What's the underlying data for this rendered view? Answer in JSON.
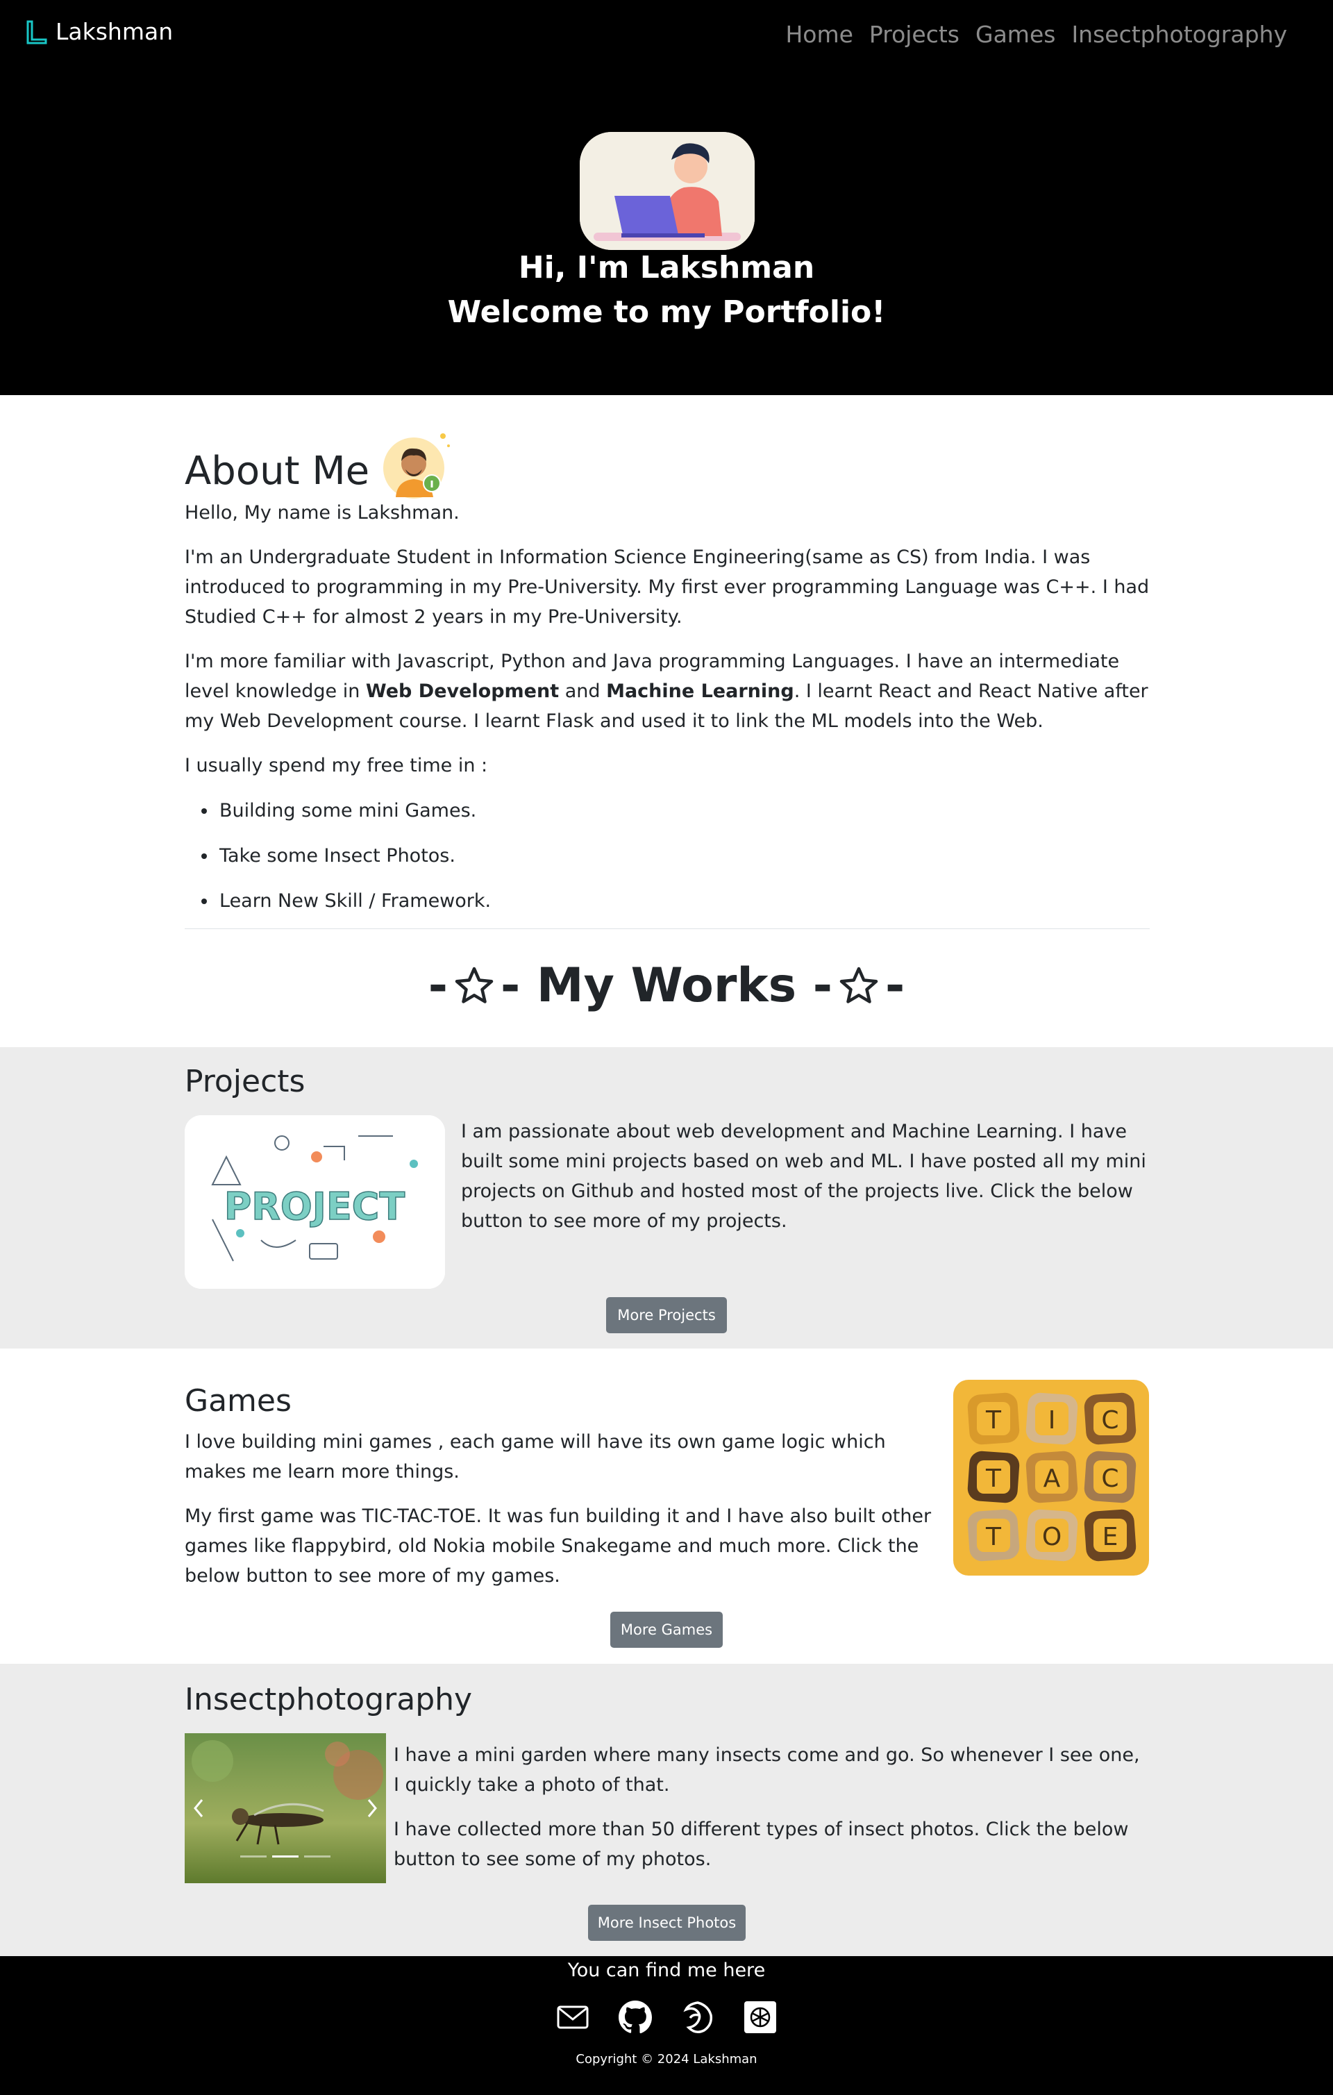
{
  "navbar": {
    "brand": "Lakshman",
    "links": [
      "Home",
      "Projects",
      "Games",
      "Insectphotography"
    ]
  },
  "hero": {
    "line1": "Hi, I'm Lakshman",
    "line2": "Welcome to my Portfolio!"
  },
  "about": {
    "title": "About Me",
    "p1": "Hello, My name is Lakshman.",
    "p2": "I'm an Undergraduate Student in Information Science Engineering(same as CS) from India. I was introduced to programming in my Pre-University. My first ever programming Language was C++. I had Studied C++ for almost 2 years in my Pre-University.",
    "p3_a": "I'm more familiar with Javascript, Python and Java programming Languages. I have an intermediate level knowledge in ",
    "p3_b": "Web Development",
    "p3_c": " and ",
    "p3_d": "Machine Learning",
    "p3_e": ". I learnt React and React Native after my Web Development course. I learnt Flask and used it to link the ML models into the Web.",
    "p4": "I usually spend my free time in :",
    "bullets": [
      "Building some mini Games.",
      "Take some Insect Photos.",
      "Learn New Skill / Framework."
    ]
  },
  "works": {
    "dash_left": "-",
    "title": "- My Works -",
    "dash_right": "-"
  },
  "projects": {
    "title": "Projects",
    "text": "I am passionate about web development and Machine Learning. I have built some mini projects based on web and ML. I have posted all my mini projects on Github and hosted most of the projects live. Click the below button to see more of my projects.",
    "button": "More Projects",
    "image_text": "PROJECT"
  },
  "games": {
    "title": "Games",
    "p1": "I love building mini games , each game will have its own game logic which makes me learn more things.",
    "p2": "My first game was TIC-TAC-TOE. It was fun building it and I have also built other games like flappybird, old Nokia mobile Snakegame and much more. Click the below button to see more of my games.",
    "button": "More Games",
    "tiles": [
      "T",
      "I",
      "C",
      "T",
      "A",
      "C",
      "T",
      "O",
      "E"
    ]
  },
  "insects": {
    "title": "Insectphotography",
    "p1": "I have a mini garden where many insects come and go. So whenever I see one, I quickly take a photo of that.",
    "p2": "I have collected more than 50 different types of insect photos. Click the below button to see some of my photos.",
    "button": "More Insect Photos"
  },
  "footer": {
    "title": "You can find me here",
    "icons": [
      "mail-icon",
      "github-icon",
      "codepen-like-icon",
      "openai-like-icon"
    ],
    "copyright": "Copyright © 2024 Lakshman"
  }
}
